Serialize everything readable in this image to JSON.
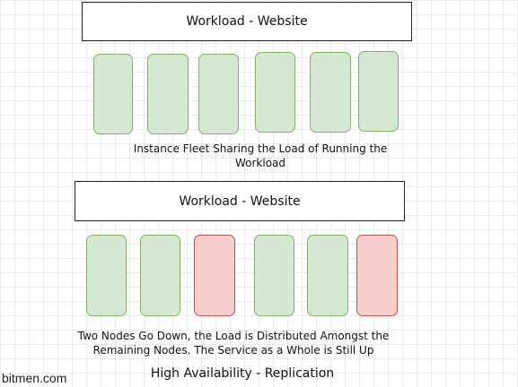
{
  "top_panel": {
    "workload_title": "Workload - Website",
    "nodes": [
      {
        "status": "up"
      },
      {
        "status": "up"
      },
      {
        "status": "up"
      },
      {
        "status": "up"
      },
      {
        "status": "up"
      },
      {
        "status": "up"
      }
    ],
    "caption_line1": "Instance Fleet Sharing the Load of Running the",
    "caption_line2": "Workload"
  },
  "bottom_panel": {
    "workload_title": "Workload - Website",
    "nodes": [
      {
        "status": "up"
      },
      {
        "status": "up"
      },
      {
        "status": "down"
      },
      {
        "status": "up"
      },
      {
        "status": "up"
      },
      {
        "status": "down"
      }
    ],
    "caption_line1": "Two Nodes Go Down, the Load is Distributed Amongst the",
    "caption_line2": "Remaining Nodes. The Service as a Whole is Still Up"
  },
  "footer": {
    "title": "High Availability - Replication",
    "watermark": "bitmen.com"
  },
  "colors": {
    "node_up_fill": "#d5e8d4",
    "node_up_border": "#82b366",
    "node_down_fill": "#f8cecc",
    "node_down_border": "#b85450"
  }
}
